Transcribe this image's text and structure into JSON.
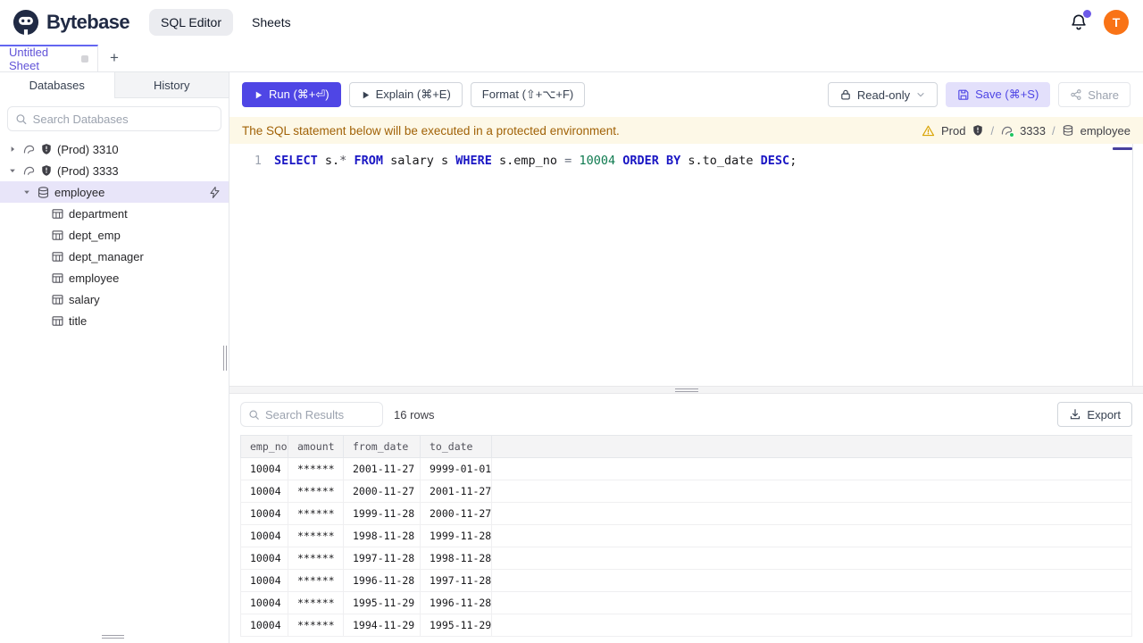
{
  "colors": {
    "accent": "#4f46e5",
    "brand_navy": "#202a44",
    "sheet_tab_purple": "#6153d8",
    "banner_bg": "#fdf8e7",
    "banner_text": "#a16207",
    "avatar_bg": "#f97316",
    "notification_dot": "#6d5ae8",
    "selected_tree_bg": "#e8e5f9",
    "sql_keyword": "#1a16c4",
    "sql_number": "#0e7a4f",
    "connection_ok": "#22c55e"
  },
  "header": {
    "brand": "Bytebase",
    "nav_sql_editor": "SQL Editor",
    "nav_sheets": "Sheets",
    "avatar_initial": "T"
  },
  "sheetbar": {
    "tab_label": "Untitled Sheet",
    "add_label": "+"
  },
  "sidebar": {
    "tab_databases": "Databases",
    "tab_history": "History",
    "search_placeholder": "Search Databases",
    "tree": [
      {
        "level": 0,
        "caret": "right",
        "icon": "mysql",
        "shield": true,
        "label": "(Prod) 3310"
      },
      {
        "level": 0,
        "caret": "down",
        "icon": "mysql",
        "shield": true,
        "label": "(Prod) 3333"
      },
      {
        "level": 1,
        "caret": "down",
        "icon": "database",
        "label": "employee",
        "selected": true,
        "action": "lightning"
      },
      {
        "level": 2,
        "icon": "table",
        "label": "department"
      },
      {
        "level": 2,
        "icon": "table",
        "label": "dept_emp"
      },
      {
        "level": 2,
        "icon": "table",
        "label": "dept_manager"
      },
      {
        "level": 2,
        "icon": "table",
        "label": "employee"
      },
      {
        "level": 2,
        "icon": "table",
        "label": "salary"
      },
      {
        "level": 2,
        "icon": "table",
        "label": "title"
      }
    ]
  },
  "toolbar": {
    "run_label": "Run (⌘+⏎)",
    "explain_label": "Explain (⌘+E)",
    "format_label": "Format (⇧+⌥+F)",
    "readonly_label": "Read-only",
    "save_label": "Save (⌘+S)",
    "share_label": "Share"
  },
  "banner": {
    "message": "The SQL statement below will be executed in a protected environment.",
    "environment": "Prod",
    "separator": "/",
    "instance": "3333",
    "database": "employee"
  },
  "editor": {
    "line_number": "1",
    "sql_text": "SELECT s.* FROM salary s WHERE s.emp_no = 10004 ORDER BY s.to_date DESC;",
    "tokens": [
      {
        "text": "SELECT",
        "type": "kw"
      },
      {
        "text": " s.",
        "type": "pl"
      },
      {
        "text": "*",
        "type": "star"
      },
      {
        "text": " ",
        "type": "pl"
      },
      {
        "text": "FROM",
        "type": "kw"
      },
      {
        "text": " salary s ",
        "type": "pl"
      },
      {
        "text": "WHERE",
        "type": "kw"
      },
      {
        "text": " s.emp_no ",
        "type": "pl"
      },
      {
        "text": "=",
        "type": "op"
      },
      {
        "text": " ",
        "type": "pl"
      },
      {
        "text": "10004",
        "type": "num"
      },
      {
        "text": " ",
        "type": "pl"
      },
      {
        "text": "ORDER BY",
        "type": "kw"
      },
      {
        "text": " s.to_date ",
        "type": "pl"
      },
      {
        "text": "DESC",
        "type": "kw"
      },
      {
        "text": ";",
        "type": "pl"
      }
    ]
  },
  "results": {
    "search_placeholder": "Search Results",
    "row_count": "16 rows",
    "export_label": "Export",
    "columns": [
      "emp_no",
      "amount",
      "from_date",
      "to_date"
    ],
    "rows": [
      [
        "10004",
        "******",
        "2001-11-27",
        "9999-01-01"
      ],
      [
        "10004",
        "******",
        "2000-11-27",
        "2001-11-27"
      ],
      [
        "10004",
        "******",
        "1999-11-28",
        "2000-11-27"
      ],
      [
        "10004",
        "******",
        "1998-11-28",
        "1999-11-28"
      ],
      [
        "10004",
        "******",
        "1997-11-28",
        "1998-11-28"
      ],
      [
        "10004",
        "******",
        "1996-11-28",
        "1997-11-28"
      ],
      [
        "10004",
        "******",
        "1995-11-29",
        "1996-11-28"
      ],
      [
        "10004",
        "******",
        "1994-11-29",
        "1995-11-29"
      ]
    ]
  }
}
